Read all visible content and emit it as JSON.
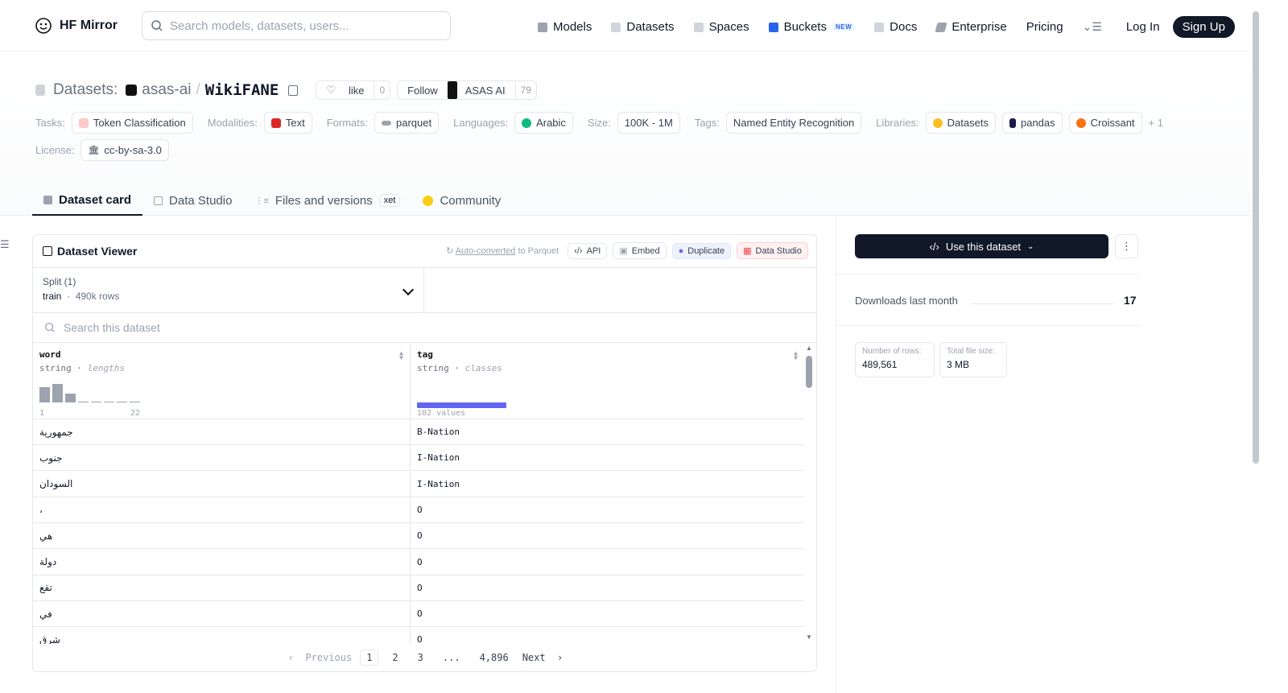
{
  "nav": {
    "logo_text": "HF Mirror",
    "search_placeholder": "Search models, datasets, users...",
    "links": [
      {
        "label": "Models",
        "icon": "cube-icon",
        "color": "#6b7280"
      },
      {
        "label": "Datasets",
        "icon": "database-icon",
        "color": "#9ca3af"
      },
      {
        "label": "Spaces",
        "icon": "grid-icon",
        "color": "#9ca3af"
      },
      {
        "label": "Buckets",
        "icon": "bucket-icon",
        "color": "#2563eb"
      },
      {
        "label": "Docs",
        "icon": "book-icon",
        "color": "#9ca3af"
      },
      {
        "label": "Enterprise",
        "icon": "enterprise-icon",
        "color": "#6b7280"
      }
    ],
    "buckets_badge": "NEW",
    "pricing": "Pricing",
    "login": "Log In",
    "signup": "Sign Up"
  },
  "dataset": {
    "prefix": "Datasets:",
    "org": "asas-ai",
    "name": "WikiFANE",
    "like_label": "like",
    "like_count": "0",
    "follow_label": "Follow",
    "follow_org": "ASAS AI",
    "follow_count": "79"
  },
  "tags": {
    "tasks_label": "Tasks:",
    "task": "Token Classification",
    "modalities_label": "Modalities:",
    "modality": "Text",
    "formats_label": "Formats:",
    "format": "parquet",
    "languages_label": "Languages:",
    "language": "Arabic",
    "size_label": "Size:",
    "size": "100K - 1M",
    "tags_label": "Tags:",
    "tag": "Named Entity Recognition",
    "libraries_label": "Libraries:",
    "libraries": [
      "Datasets",
      "pandas",
      "Croissant"
    ],
    "more": "+ 1",
    "license_label": "License:",
    "license": "cc-by-sa-3.0"
  },
  "tabs": {
    "dataset_card": "Dataset card",
    "data_studio": "Data Studio",
    "files": "Files and versions",
    "xet": "xet",
    "community": "Community"
  },
  "viewer": {
    "title": "Dataset Viewer",
    "auto_converted": "Auto-converted",
    "to_parquet": "to Parquet",
    "api": "API",
    "embed": "Embed",
    "duplicate": "Duplicate",
    "data_studio": "Data Studio",
    "split_label": "Split (1)",
    "split_name": "train",
    "split_rows": "490k rows",
    "search_placeholder": "Search this dataset",
    "columns": [
      {
        "name": "word",
        "type": "string",
        "stat": "lengths",
        "min": "1",
        "max": "22"
      },
      {
        "name": "tag",
        "type": "string",
        "stat": "classes",
        "summary": "102 values"
      }
    ],
    "histogram": [
      0.72,
      0.9,
      0.42,
      0.04,
      0.04,
      0.04,
      0.04,
      0.04
    ],
    "rows": [
      {
        "word": "جمهورية",
        "tag": "B-Nation"
      },
      {
        "word": "جنوب",
        "tag": "I-Nation"
      },
      {
        "word": "السودان",
        "tag": "I-Nation"
      },
      {
        "word": "،",
        "tag": "O"
      },
      {
        "word": "هي",
        "tag": "O"
      },
      {
        "word": "دولة",
        "tag": "O"
      },
      {
        "word": "تقع",
        "tag": "O"
      },
      {
        "word": "في",
        "tag": "O"
      },
      {
        "word": "شرق",
        "tag": "O"
      }
    ],
    "pager": {
      "previous": "Previous",
      "next": "Next",
      "pages": [
        "1",
        "2",
        "3",
        "...",
        "4,896"
      ]
    }
  },
  "sidebar": {
    "use_button": "Use this dataset",
    "downloads_label": "Downloads last month",
    "downloads_value": "17",
    "rows_label": "Number of rows:",
    "rows_value": "489,561",
    "size_label": "Total file size:",
    "size_value": "3 MB"
  }
}
